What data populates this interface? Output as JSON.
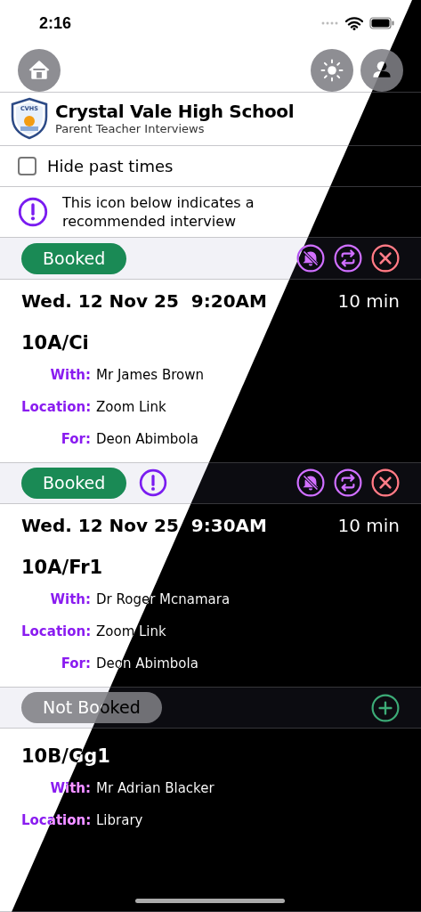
{
  "status_bar": {
    "time": "2:16"
  },
  "school": {
    "name": "Crystal Vale High School",
    "subtitle": "Parent Teacher Interviews",
    "logo_text": "CVHS"
  },
  "hide_past": {
    "label": "Hide past times",
    "checked": false
  },
  "info": {
    "text": "This icon below indicates a recommended interview"
  },
  "interviews": [
    {
      "status": "Booked",
      "kind": "booked",
      "recommended": false,
      "actions": [
        {
          "kind": "mute"
        },
        {
          "kind": "swap"
        },
        {
          "kind": "cancel"
        }
      ],
      "date": "Wed. 12 Nov 25  9:20AM",
      "duration": "10 min",
      "class": "10A/Ci",
      "fields": [
        {
          "label": "With:",
          "value": "Mr James Brown"
        },
        {
          "label": "Location:",
          "value": "Zoom Link"
        },
        {
          "label": "For:",
          "value": "Deon Abimbola"
        }
      ]
    },
    {
      "status": "Booked",
      "kind": "booked",
      "recommended": true,
      "actions": [
        {
          "kind": "mute"
        },
        {
          "kind": "swap"
        },
        {
          "kind": "cancel"
        }
      ],
      "date": "Wed. 12 Nov 25  9:30AM",
      "duration": "10 min",
      "class": "10A/Fr1",
      "fields": [
        {
          "label": "With:",
          "value": "Dr Roger Mcnamara"
        },
        {
          "label": "Location:",
          "value": "Zoom Link"
        },
        {
          "label": "For:",
          "value": "Deon Abimbola"
        }
      ]
    },
    {
      "status": "Not Booked",
      "kind": "not_booked",
      "recommended": false,
      "actions": [
        {
          "kind": "add"
        }
      ],
      "class": "10B/Gg1",
      "fields": [
        {
          "label": "With:",
          "value": "Mr Adrian Blacker"
        },
        {
          "label": "Location:",
          "value": "Library"
        }
      ]
    }
  ]
}
